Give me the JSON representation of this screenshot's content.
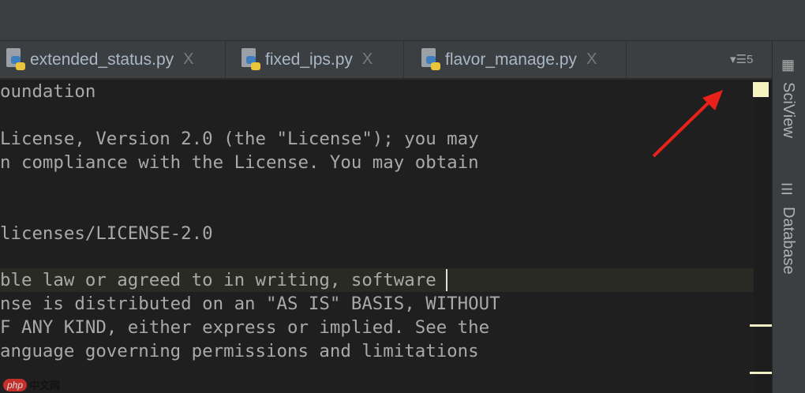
{
  "tabs": [
    {
      "label": "extended_status.py"
    },
    {
      "label": "fixed_ips.py"
    },
    {
      "label": "flavor_manage.py"
    }
  ],
  "tab_close": "X",
  "tab_count": "5",
  "side_tools": {
    "sciview": "SciView",
    "database": "Database"
  },
  "code_lines": [
    "oundation",
    "",
    "License, Version 2.0 (the \"License\"); you may",
    "n compliance with the License. You may obtain",
    "",
    "",
    "licenses/LICENSE-2.0",
    "",
    "ble law or agreed to in writing, software",
    "nse is distributed on an \"AS IS\" BASIS, WITHOUT",
    "F ANY KIND, either express or implied. See the",
    "anguage governing permissions and limitations"
  ],
  "watermark": "php中文网",
  "colors": {
    "annotation_arrow": "#e8221b",
    "error_stripe": "#f6f3c0"
  }
}
